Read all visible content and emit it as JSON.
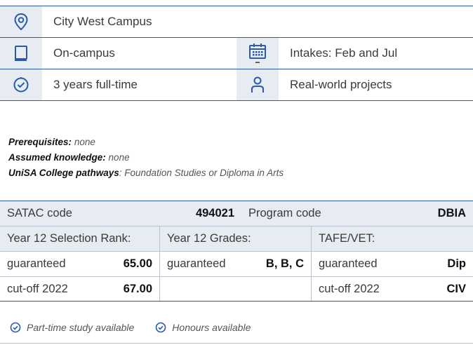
{
  "info": {
    "campus": "City West Campus",
    "mode": "On-campus",
    "intakes": "Intakes: Feb and Jul",
    "duration": "3 years full-time",
    "projects": "Real-world projects"
  },
  "requirements": {
    "prerequisites_label": "Prerequisites:",
    "prerequisites_value": "none",
    "assumed_label": "Assumed knowledge:",
    "assumed_value": "none",
    "pathways_label": "UniSA College pathways",
    "pathways_value": ": Foundation Studies or Diploma in Arts"
  },
  "codes": {
    "satac_label": "SATAC code",
    "satac_value": "494021",
    "program_label": "Program code",
    "program_value": "DBIA",
    "col1_header": "Year 12 Selection Rank:",
    "col2_header": "Year 12 Grades:",
    "col3_header": "TAFE/VET:",
    "rows": [
      {
        "c1_label": "guaranteed",
        "c1_value": "65.00",
        "c2_label": "guaranteed",
        "c2_value": "B, B, C",
        "c3_label": "guaranteed",
        "c3_value": "Dip"
      },
      {
        "c1_label": "cut-off 2022",
        "c1_value": "67.00",
        "c2_label": "",
        "c2_value": "",
        "c3_label": "cut-off 2022",
        "c3_value": "CIV"
      }
    ]
  },
  "availability": {
    "part_time": "Part-time study available",
    "honours": "Honours available"
  },
  "colors": {
    "accent": "#2a5aa8",
    "icon_bg": "#e7ecf3"
  }
}
